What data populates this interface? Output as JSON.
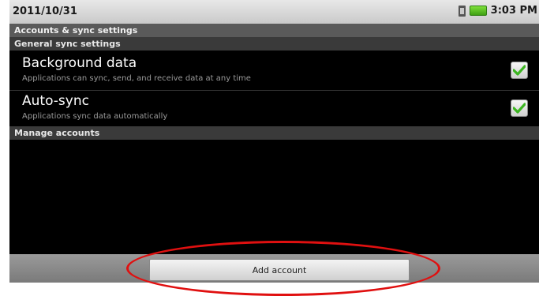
{
  "statusbar": {
    "date": "2011/10/31",
    "time": "3:03 PM"
  },
  "title": "Accounts & sync settings",
  "sections": {
    "general": "General sync settings",
    "manage": "Manage accounts"
  },
  "prefs": [
    {
      "title": "Background data",
      "summary": "Applications can sync, send, and receive data at any time",
      "checked": true
    },
    {
      "title": "Auto-sync",
      "summary": "Applications sync data automatically",
      "checked": true
    }
  ],
  "bottom": {
    "add_account_label": "Add account"
  },
  "colors": {
    "check_green": "#3cb521",
    "annotation_red": "#e01010"
  }
}
